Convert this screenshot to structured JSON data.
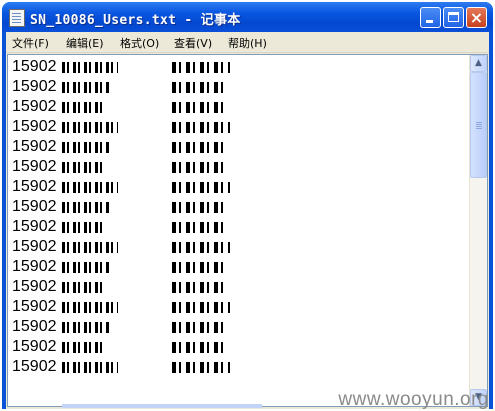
{
  "window": {
    "title": "SN_10086_Users.txt - 记事本",
    "buttons": {
      "minimize": "minimize",
      "maximize": "maximize",
      "close": "×"
    }
  },
  "menu": {
    "items": [
      {
        "label": "文件(F)"
      },
      {
        "label": "编辑(E)"
      },
      {
        "label": "格式(O)"
      },
      {
        "label": "查看(V)"
      },
      {
        "label": "帮助(H)"
      }
    ]
  },
  "editor": {
    "lines": [
      "15902",
      "15902",
      "15902",
      "15902",
      "15902",
      "15902",
      "15902",
      "15902",
      "15902",
      "15902",
      "15902",
      "15902",
      "15902",
      "15902",
      "15902",
      "15902"
    ]
  },
  "scrollbar": {
    "up_arrow": "▲",
    "down_arrow": "▼"
  },
  "watermark": "www.wooyun.org",
  "colors": {
    "title_bar": "#0a58e2",
    "close_button": "#c6421c",
    "window_bg": "#ece9d8",
    "text": "#000000"
  }
}
